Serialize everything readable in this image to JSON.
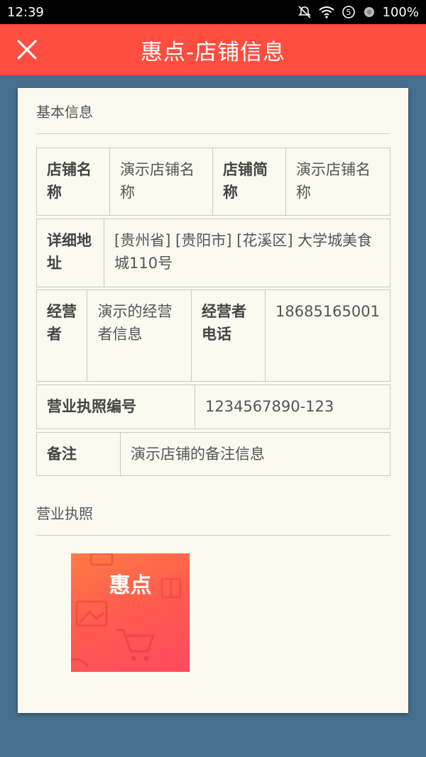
{
  "statusbar": {
    "time": "12:39",
    "battery": "100%",
    "icons": [
      "notification-off-icon",
      "wifi-icon",
      "sim-5-icon",
      "record-icon"
    ]
  },
  "appbar": {
    "title": "惠点-店铺信息",
    "close_icon": "close-icon",
    "background": "#ff4d40"
  },
  "basic_info": {
    "section_title": "基本信息",
    "store_name_label": "店铺名称",
    "store_name_value": "演示店铺名称",
    "store_short_label": "店铺简称",
    "store_short_value": "演示店铺名称",
    "address_label": "详细地址",
    "address_value": "[贵州省] [贵阳市] [花溪区]   大学城美食城110号",
    "operator_label": "经营者",
    "operator_value": "演示的经营者信息",
    "phone_label": "经营者电话",
    "phone_value": "18685165001",
    "license_no_label": "营业执照编号",
    "license_no_value": "1234567890-123",
    "remark_label": "备注",
    "remark_value": "演示店铺的备注信息"
  },
  "license": {
    "section_title": "营业执照",
    "image_brand_text": "惠点"
  },
  "colors": {
    "page_background": "#466f8f",
    "card_background": "#fafaf0",
    "accent": "#ff4d40"
  }
}
